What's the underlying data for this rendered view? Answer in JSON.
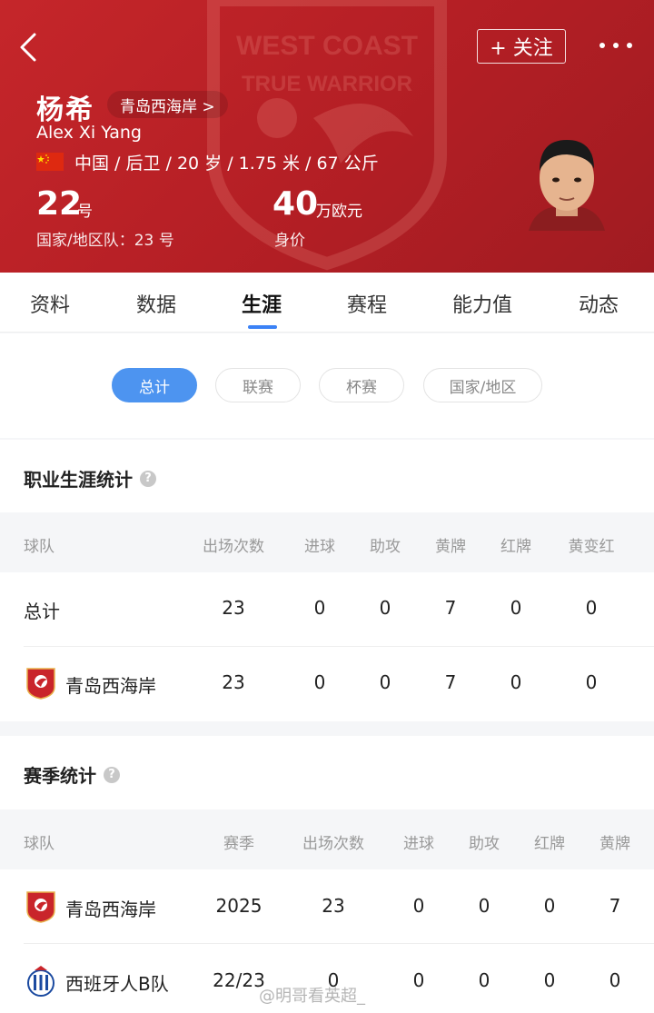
{
  "header": {
    "back_icon": "chevron-left-icon",
    "follow_label": "+ 关注",
    "more_icon": "more-dots-icon",
    "player_name": "杨希",
    "club_link": "青岛西海岸 >",
    "english_name": "Alex Xi Yang",
    "bio": "中国 / 后卫 / 20 岁 / 1.75 米 / 67 公斤",
    "shirt_number": "22",
    "shirt_unit": "号",
    "national_team_number": "国家/地区队：23 号",
    "market_value": "40",
    "market_value_unit": "万欧元",
    "market_value_label": "身价",
    "crest_text_top": "WEST COAST",
    "crest_text_mid": "TRUE WARRIOR"
  },
  "tabs": [
    "资料",
    "数据",
    "生涯",
    "赛程",
    "能力值",
    "动态"
  ],
  "active_tab": "生涯",
  "filters": [
    "总计",
    "联赛",
    "杯赛",
    "国家/地区"
  ],
  "active_filter": "总计",
  "career": {
    "title": "职业生涯统计",
    "columns": [
      "球队",
      "出场次数",
      "进球",
      "助攻",
      "黄牌",
      "红牌",
      "黄变红"
    ],
    "rows": [
      {
        "team": "总计",
        "apps": "23",
        "goals": "0",
        "assists": "0",
        "yellow": "7",
        "red": "0",
        "yellow_red": "0"
      },
      {
        "team": "青岛西海岸",
        "apps": "23",
        "goals": "0",
        "assists": "0",
        "yellow": "7",
        "red": "0",
        "yellow_red": "0"
      }
    ]
  },
  "season": {
    "title": "赛季统计",
    "columns": [
      "球队",
      "赛季",
      "出场次数",
      "进球",
      "助攻",
      "红牌",
      "黄牌"
    ],
    "rows": [
      {
        "team": "青岛西海岸",
        "season": "2025",
        "apps": "23",
        "goals": "0",
        "assists": "0",
        "red": "0",
        "yellow": "7"
      },
      {
        "team": "西班牙人B队",
        "season": "22/23",
        "apps": "0",
        "goals": "0",
        "assists": "0",
        "red": "0",
        "yellow": "0"
      }
    ]
  },
  "watermark": "@明哥看英超_",
  "colors": {
    "hero": "#b51f25",
    "accent": "#4d94f0"
  }
}
